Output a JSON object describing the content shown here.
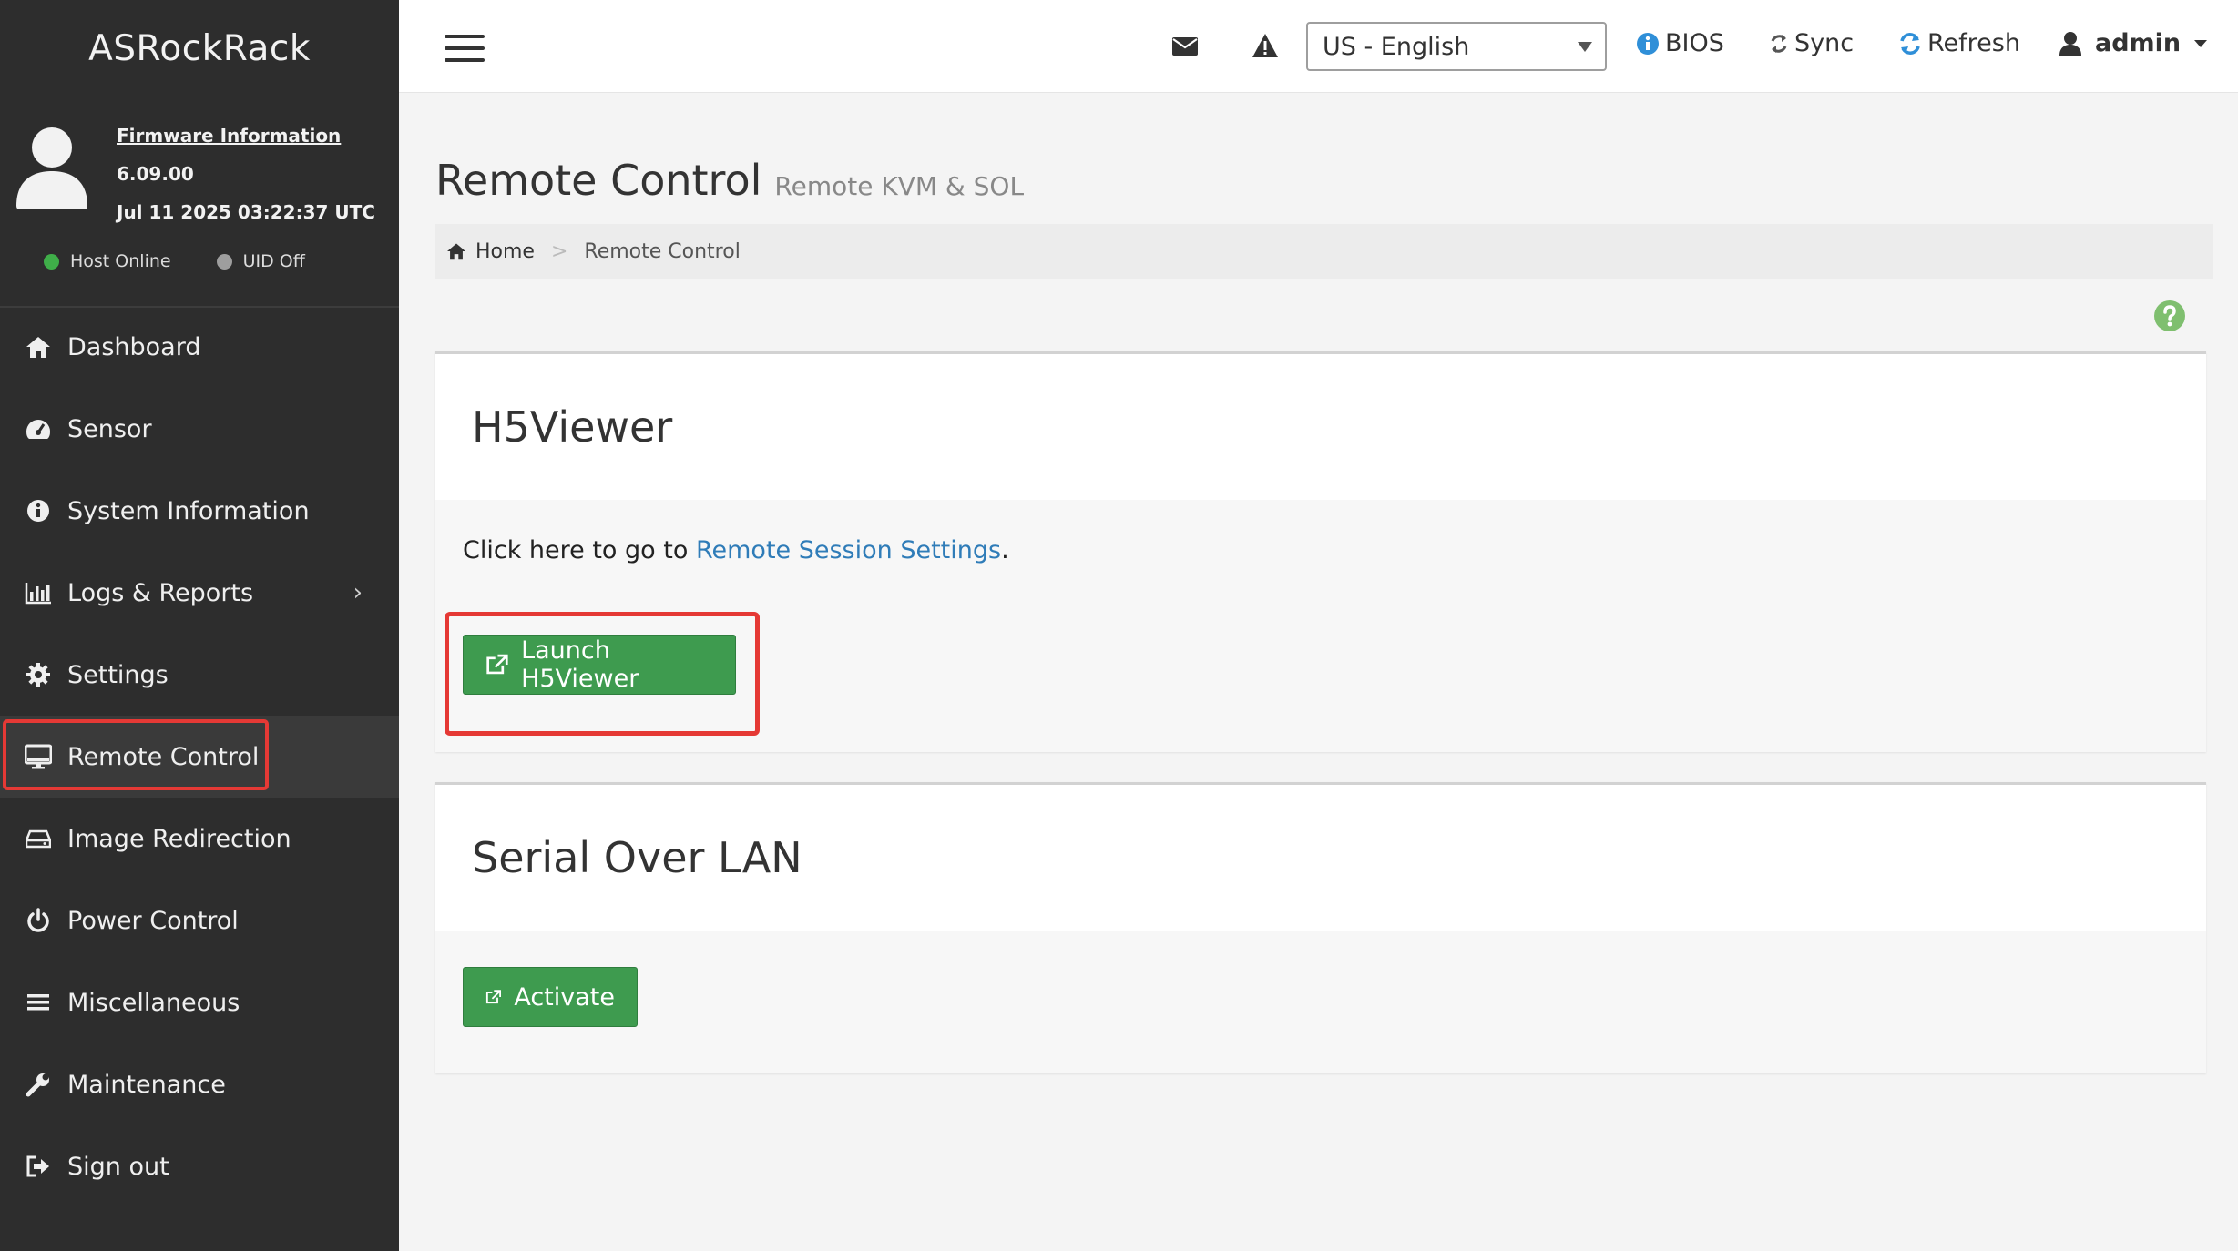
{
  "brand": "ASRockRack",
  "firmware": {
    "title": "Firmware Information",
    "version": "6.09.00",
    "date": "Jul 11 2025 03:22:37 UTC"
  },
  "status": {
    "host": {
      "label": "Host Online",
      "color": "#3fae49"
    },
    "uid": {
      "label": "UID Off",
      "color": "#9e9e9e"
    }
  },
  "sidebar": {
    "items": [
      {
        "label": "Dashboard",
        "icon": "home-icon"
      },
      {
        "label": "Sensor",
        "icon": "dashboard-gauge-icon"
      },
      {
        "label": "System Information",
        "icon": "info-icon"
      },
      {
        "label": "Logs & Reports",
        "icon": "bar-chart-icon",
        "chevron": "›"
      },
      {
        "label": "Settings",
        "icon": "gear-icon"
      },
      {
        "label": "Remote Control",
        "icon": "monitor-icon",
        "active": true
      },
      {
        "label": "Image Redirection",
        "icon": "drive-icon"
      },
      {
        "label": "Power Control",
        "icon": "power-icon"
      },
      {
        "label": "Miscellaneous",
        "icon": "list-icon"
      },
      {
        "label": "Maintenance",
        "icon": "wrench-icon"
      },
      {
        "label": "Sign out",
        "icon": "sign-out-icon"
      }
    ]
  },
  "topbar": {
    "language": "US - English",
    "bios": "BIOS",
    "sync": "Sync",
    "refresh": "Refresh",
    "user": "admin"
  },
  "page": {
    "title": "Remote Control",
    "subtitle": "Remote KVM & SOL",
    "breadcrumb": {
      "home": "Home",
      "separator": ">",
      "current": "Remote Control"
    }
  },
  "h5viewer": {
    "heading": "H5Viewer",
    "text_prefix": "Click here to go to ",
    "link": "Remote Session Settings",
    "text_suffix": ".",
    "button": "Launch H5Viewer"
  },
  "sol": {
    "heading": "Serial Over LAN",
    "button": "Activate"
  },
  "colors": {
    "accent_green": "#3e9b4f",
    "link_blue": "#2f7cb8",
    "highlight_red": "#e53935",
    "sidebar_bg": "#2d2d2d"
  }
}
